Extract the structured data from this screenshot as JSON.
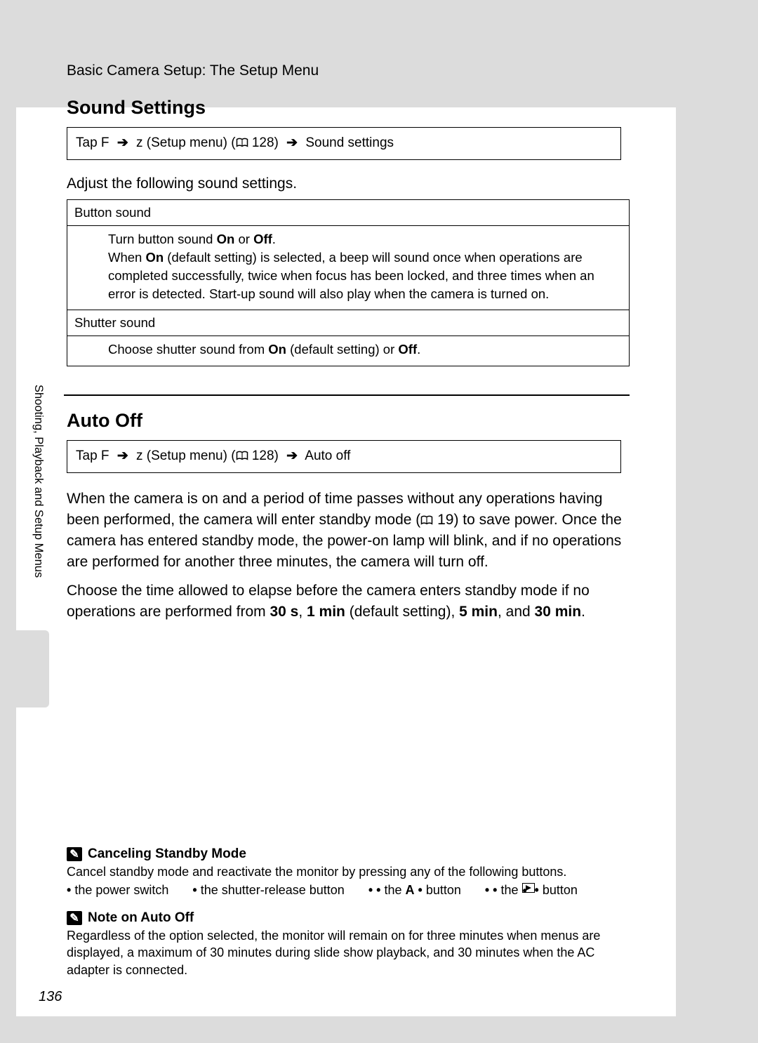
{
  "header": "Basic Camera Setup: The Setup Menu",
  "side_label": "Shooting, Playback and Setup Menus",
  "page_number": "136",
  "sections": {
    "sound": {
      "title": "Sound Settings",
      "nav": {
        "tap": "Tap F",
        "setup_glyph": "z",
        "setup_label": "(Setup menu) (",
        "ref": "128)",
        "dest": "Sound settings"
      },
      "intro": "Adjust the following sound settings.",
      "rows": [
        {
          "label": "Button sound",
          "prefix": "Turn button sound ",
          "b1": "On",
          "mid1": " or ",
          "b2": "Off",
          "suffix1": ".",
          "line2a": "When ",
          "line2b": "On",
          "line2c": " (default setting) is selected, a beep will sound once when operations are completed successfully, twice when focus has been locked, and three times when an error is detected. Start-up sound will also play when the camera is turned on."
        },
        {
          "label": "Shutter sound",
          "prefix": "Choose shutter sound from ",
          "b1": "On",
          "mid1": " (default setting) or ",
          "b2": "Off",
          "suffix1": "."
        }
      ]
    },
    "autooff": {
      "title": "Auto Off",
      "nav": {
        "tap": "Tap F",
        "setup_glyph": "z",
        "setup_label": "(Setup menu) (",
        "ref": "128)",
        "dest": "Auto off"
      },
      "para1a": "When the camera is on and a period of time passes without any operations having been performed, the camera will enter standby mode (",
      "para1ref": "19) to save power. Once the camera has entered standby mode, the power-on lamp will blink, and if no operations are performed for another three minutes, the camera will turn off.",
      "para2a": "Choose the time allowed to elapse before the camera enters standby mode if no operations are performed from ",
      "opt1": "30 s",
      "sep1": ", ",
      "opt2": "1 min",
      "sep2": " (default setting), ",
      "opt3": "5 min",
      "sep3": ", and ",
      "opt4": "30 min",
      "end": "."
    }
  },
  "notes": {
    "cancel": {
      "title": "Canceling Standby Mode",
      "body": "Cancel standby mode and reactivate the monitor by pressing any of the following buttons.",
      "bullets": {
        "b1": "the power switch",
        "b2": "the shutter-release button",
        "b3a": "the ",
        "b3glyph": "A",
        "b3b": " button",
        "b4a": "the ",
        "b4b": " button"
      }
    },
    "auto": {
      "title": "Note on Auto Off",
      "body": "Regardless of the option selected, the monitor will remain on for three minutes when menus are displayed, a maximum of 30 minutes during slide show playback, and 30 minutes when the AC adapter is connected."
    }
  }
}
